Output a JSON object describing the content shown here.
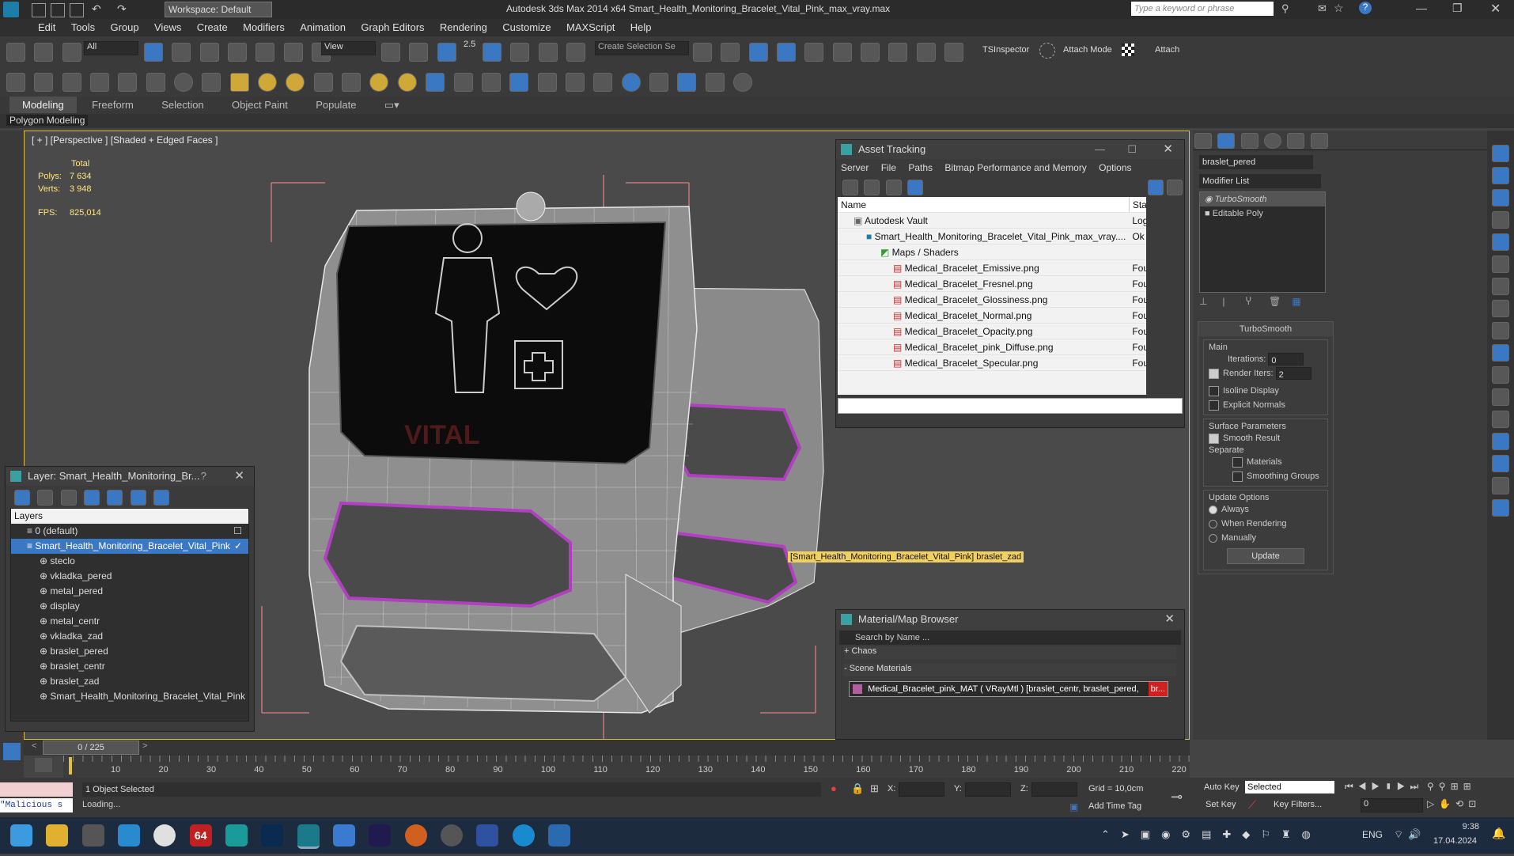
{
  "window": {
    "title": "Autodesk 3ds Max  2014 x64     Smart_Health_Monitoring_Bracelet_Vital_Pink_max_vray.max",
    "workspace": "Workspace: Default",
    "search_placeholder": "Type a keyword or phrase"
  },
  "menu": [
    "Edit",
    "Tools",
    "Group",
    "Views",
    "Create",
    "Modifiers",
    "Animation",
    "Graph Editors",
    "Rendering",
    "Customize",
    "MAXScript",
    "Help"
  ],
  "toolbar": {
    "selection_filter": "All",
    "ref_coord": "View",
    "snap_value": "2.5",
    "selection_set_placeholder": "Create Selection Se",
    "tsinspector": "TSInspector",
    "attach_mode": "Attach Mode",
    "attach": "Attach"
  },
  "ribbon": {
    "tabs": [
      "Modeling",
      "Freeform",
      "Selection",
      "Object Paint",
      "Populate"
    ],
    "active": "Modeling",
    "sub": "Polygon Modeling"
  },
  "viewport": {
    "label": "[ + ] [Perspective ] [Shaded + Edged Faces ]",
    "stats_header": "Total",
    "polys_label": "Polys:",
    "polys": "7 634",
    "verts_label": "Verts:",
    "verts": "3 948",
    "fps_label": "FPS:",
    "fps": "825,014",
    "tooltip": "[Smart_Health_Monitoring_Bracelet_Vital_Pink] braslet_zad",
    "watermark": "VITAL"
  },
  "asset_tracking": {
    "title": "Asset Tracking",
    "menu": [
      "Server",
      "File",
      "Paths",
      "Bitmap Performance and Memory",
      "Options"
    ],
    "col_name": "Name",
    "col_status": "Status",
    "rows": [
      {
        "name": "Autodesk Vault",
        "status": "Logged Out"
      },
      {
        "name": "Smart_Health_Monitoring_Bracelet_Vital_Pink_max_vray....",
        "status": "Ok"
      },
      {
        "name": "Maps / Shaders",
        "status": ""
      },
      {
        "name": "Medical_Bracelet_Emissive.png",
        "status": "Found"
      },
      {
        "name": "Medical_Bracelet_Fresnel.png",
        "status": "Found"
      },
      {
        "name": "Medical_Bracelet_Glossiness.png",
        "status": "Found"
      },
      {
        "name": "Medical_Bracelet_Normal.png",
        "status": "Found"
      },
      {
        "name": "Medical_Bracelet_Opacity.png",
        "status": "Found"
      },
      {
        "name": "Medical_Bracelet_pink_Diffuse.png",
        "status": "Found"
      },
      {
        "name": "Medical_Bracelet_Specular.png",
        "status": "Found"
      }
    ]
  },
  "layer_dialog": {
    "title": "Layer: Smart_Health_Monitoring_Br...",
    "help": "?",
    "header": "Layers",
    "items": [
      "0 (default)",
      "Smart_Health_Monitoring_Bracelet_Vital_Pink",
      "steclo",
      "vkladka_pered",
      "metal_pered",
      "display",
      "metal_centr",
      "vkladka_zad",
      "braslet_pered",
      "braslet_centr",
      "braslet_zad",
      "Smart_Health_Monitoring_Bracelet_Vital_Pink"
    ]
  },
  "material_browser": {
    "title": "Material/Map Browser",
    "search_placeholder": "Search by Name ...",
    "chaos": "+ Chaos",
    "scene_materials": "- Scene Materials",
    "material": "Medical_Bracelet_pink_MAT ( VRayMtl ) [braslet_centr, braslet_pered,",
    "material_tail": "br..."
  },
  "command_panel": {
    "object_name": "braslet_pered",
    "modifier_list": "Modifier List",
    "stack": [
      "TurboSmooth",
      "Editable Poly"
    ],
    "rollout": "TurboSmooth",
    "main": "Main",
    "iterations_label": "Iterations:",
    "iterations": "0",
    "render_iters_label": "Render Iters:",
    "render_iters": "2",
    "isoline": "Isoline Display",
    "explicit": "Explicit Normals",
    "surface_params": "Surface Parameters",
    "smooth_result": "Smooth Result",
    "separate": "Separate",
    "materials": "Materials",
    "smoothing_groups": "Smoothing Groups",
    "update_options": "Update Options",
    "always": "Always",
    "when_rendering": "When Rendering",
    "manually": "Manually",
    "update_btn": "Update"
  },
  "timeline": {
    "frame": "0 / 225",
    "ticks": [
      "10",
      "20",
      "30",
      "40",
      "50",
      "60",
      "70",
      "80",
      "90",
      "100",
      "110",
      "120",
      "130",
      "140",
      "150",
      "160",
      "170",
      "180",
      "190",
      "200",
      "210",
      "220"
    ]
  },
  "status": {
    "selected": "1 Object Selected",
    "loading": "Loading...",
    "script": "\"Malicious s",
    "x_label": "X:",
    "y_label": "Y:",
    "z_label": "Z:",
    "grid": "Grid = 10,0cm",
    "add_time_tag": "Add Time Tag",
    "auto_key": "Auto Key",
    "set_key": "Set Key",
    "selected_dd": "Selected",
    "key_filters": "Key Filters...",
    "frame_field": "0"
  },
  "taskbar": {
    "lang": "ENG",
    "time": "9:38",
    "date": "17.04.2024",
    "badge": "64"
  },
  "colors": {
    "accent": "#3b78c4",
    "viewport_border": "#e0c040",
    "pink_wire": "#b040c0",
    "tooltip_bg": "#f0d060"
  }
}
